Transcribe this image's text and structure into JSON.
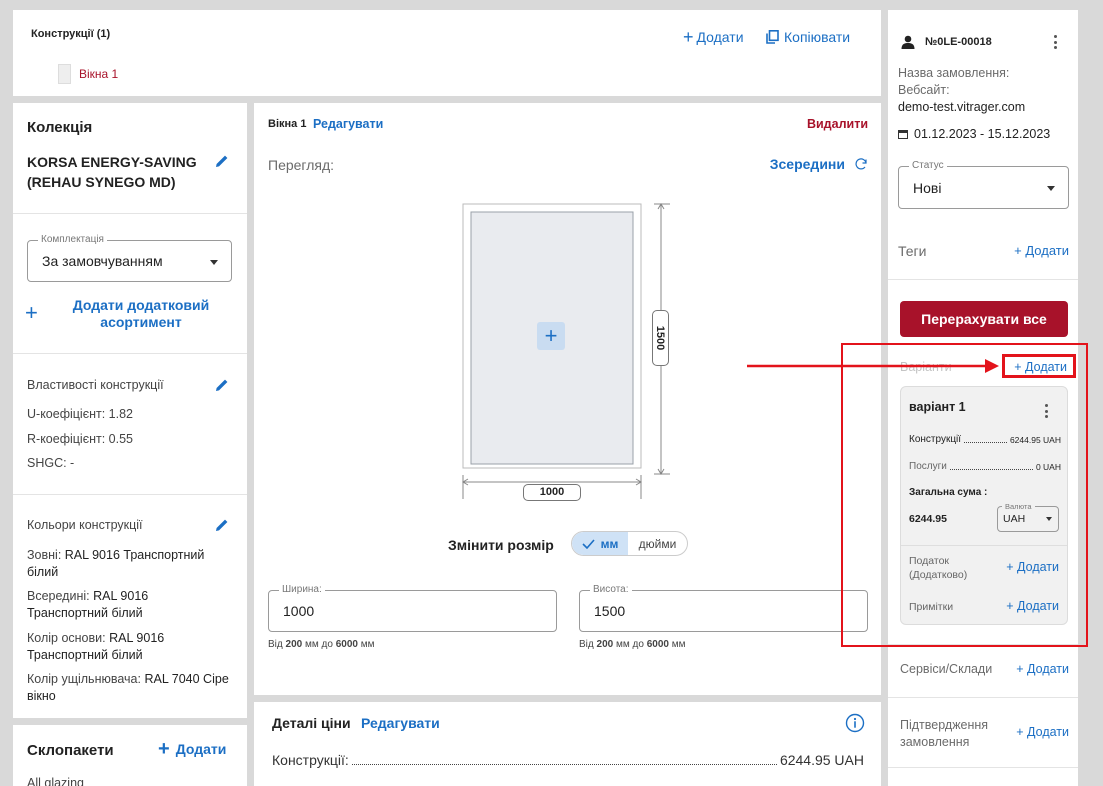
{
  "constructions": {
    "title": "Конструкції (1)",
    "item_label": "Вікна 1",
    "add_label": "Додати",
    "copy_label": "Копіювати"
  },
  "collection": {
    "heading": "Колекція",
    "name": "KORSA ENERGY-SAVING (REHAU SYNEGO MD)",
    "config_label": "Комплектація",
    "config_value": "За замовчуванням",
    "add_assortment": "Додати додатковий асортимент",
    "props_title": "Властивості конструкції",
    "props": [
      "U-коефіцієнт: 1.82",
      "R-коефіцієнт: 0.55",
      "SHGC: -"
    ],
    "colors_title": "Кольори конструкції",
    "colors": [
      {
        "label": "Зовні:",
        "value": "RAL 9016 Транспортний білий"
      },
      {
        "label": "Всередині:",
        "value": "RAL 9016 Транспортний білий"
      },
      {
        "label": "Колір основи:",
        "value": "RAL 9016 Транспортний білий"
      },
      {
        "label": "Колір ущільнювача:",
        "value": "RAL 7040 Сіре вікно"
      }
    ],
    "glazing_title": "Склопакети",
    "glazing_add": "Додати",
    "glazing_first": "All glazing"
  },
  "editor": {
    "item_label": "Вікна 1",
    "edit_label": "Редагувати",
    "delete_label": "Видалити",
    "preview_label": "Перегляд:",
    "view_mode": "Зсередини",
    "height_dim": "1500",
    "width_dim": "1000",
    "resize_label": "Змінити розмір",
    "unit_mm": "мм",
    "unit_inch": "дюйми",
    "width_field_label": "Ширина:",
    "width_value": "1000",
    "height_field_label": "Висота:",
    "height_value": "1500",
    "range_prefix": "Від",
    "range_min": "200",
    "range_mid": "мм до",
    "range_max": "6000",
    "range_unit": "мм"
  },
  "price_details": {
    "title": "Деталі ціни",
    "edit_label": "Редагувати",
    "line_label": "Конструкції:",
    "line_value": "6244.95 UAH"
  },
  "order": {
    "number": "№0LE-00018",
    "name_label": "Назва замовлення:",
    "website_label": "Вебсайт:",
    "website": "demo-test.vitrager.com",
    "dates": "01.12.2023 - 15.12.2023",
    "status_label": "Статус",
    "status_value": "Нові",
    "tags_label": "Теги",
    "tags_add": "+ Додати",
    "recalc_label": "Перерахувати все",
    "variants_label": "Варіанти",
    "variants_add": "+ Додати",
    "variant": {
      "name": "варіант 1",
      "constructions_label": "Конструкції",
      "constructions_value": "6244.95 UAH",
      "services_label": "Послуги",
      "services_value": "0 UAH",
      "total_label": "Загальна сума :",
      "total_value": "6244.95",
      "currency_label": "Валюта",
      "currency_value": "UAH",
      "tax_label": "Податок (Додатково)",
      "tax_add": "+ Додати",
      "notes_label": "Примітки",
      "notes_add": "+ Додати"
    },
    "services_label": "Сервіси/Склади",
    "services_add": "+ Додати",
    "confirm_label": "Підтвердження замовлення",
    "confirm_add": "+ Додати"
  },
  "colors": {
    "accent_blue": "#1c6fc4",
    "danger_red": "#a8122a",
    "highlight_red": "#e3131b"
  }
}
